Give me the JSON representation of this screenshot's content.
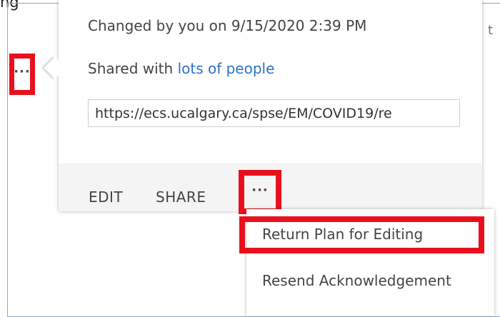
{
  "page": {
    "top_label": "ng",
    "edge_char": "t"
  },
  "row": {
    "ellipsis_label": "···"
  },
  "callout": {
    "changed_text": "Changed by you on 9/15/2020 2:39 PM",
    "shared_prefix": "Shared with",
    "shared_link": "lots of people",
    "url_value": "https://ecs.ucalgary.ca/spse/EM/COVID19/re",
    "actions": {
      "edit_label": "EDIT",
      "share_label": "SHARE",
      "more_label": "···"
    }
  },
  "context_menu": {
    "items": [
      {
        "label": "Return Plan for Editing"
      },
      {
        "label": "Resend Acknowledgement"
      }
    ]
  },
  "colors": {
    "highlight": "#e8101c",
    "link": "#2a72c8",
    "action_bar": "#f4f4f4"
  }
}
